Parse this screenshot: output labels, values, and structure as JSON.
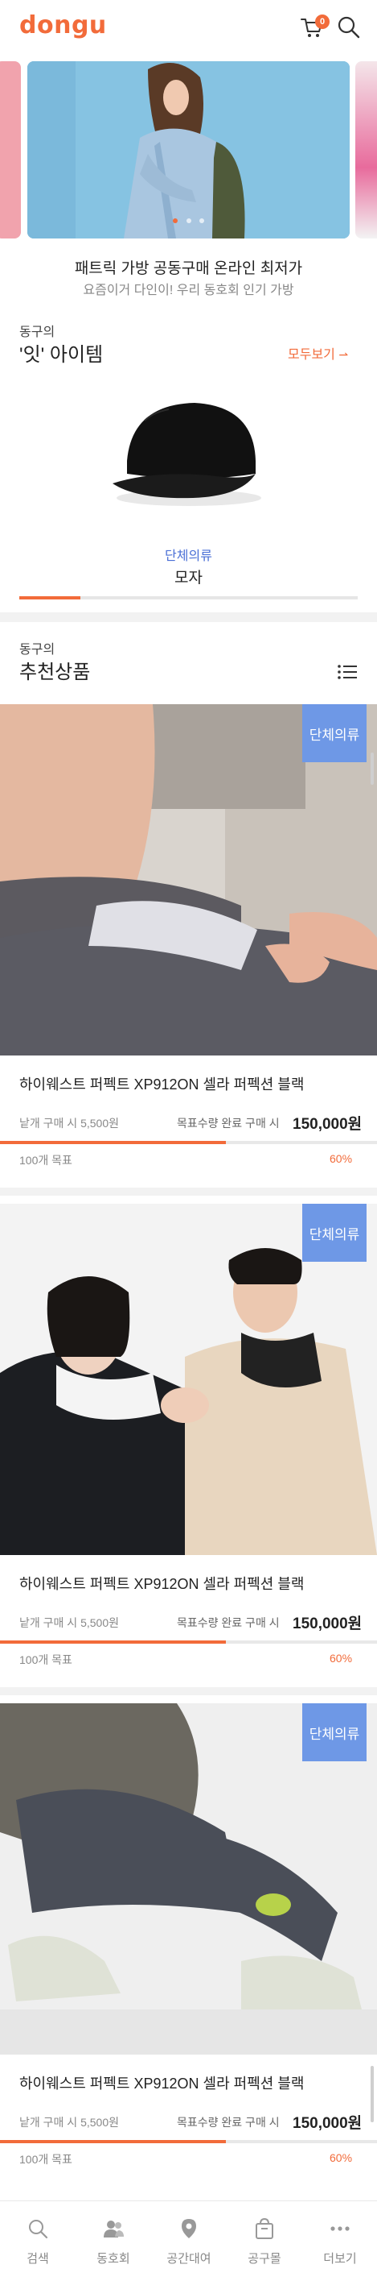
{
  "header": {
    "logo": "dongu",
    "cart_count": "0"
  },
  "banner": {
    "title": "패트릭 가방 공동구매 온라인 최저가",
    "subtitle": "요즘이거 다인이! 우리 동호회 인기 가방",
    "slide_count": 3,
    "active_slide": 1
  },
  "it_items": {
    "eyebrow": "동구의",
    "title": "'잇' 아이템",
    "see_all": "모두보기",
    "item": {
      "category": "단체의류",
      "name": "모자"
    },
    "scroll_progress": 0.18
  },
  "recommended": {
    "eyebrow": "동구의",
    "title": "추천상품",
    "products": [
      {
        "badge": "단체의류",
        "name": "하이웨스트 퍼펙트 XP912ON 셀라 퍼펙션 블랙",
        "unit_price_label": "낱개 구매 시 5,500원",
        "goal_label": "목표수량 완료 구매 시",
        "goal_price": "150,000원",
        "target": "100개 목표",
        "percent_label": "60%",
        "progress": 0.6
      },
      {
        "badge": "단체의류",
        "name": "하이웨스트 퍼펙트 XP912ON 셀라 퍼펙션 블랙",
        "unit_price_label": "낱개 구매 시 5,500원",
        "goal_label": "목표수량 완료 구매 시",
        "goal_price": "150,000원",
        "target": "100개 목표",
        "percent_label": "60%",
        "progress": 0.6
      },
      {
        "badge": "단체의류",
        "name": "하이웨스트 퍼펙트 XP912ON 셀라 퍼펙션 블랙",
        "unit_price_label": "낱개 구매 시 5,500원",
        "goal_label": "목표수량 완료 구매 시",
        "goal_price": "150,000원",
        "target": "100개 목표",
        "percent_label": "60%",
        "progress": 0.6
      }
    ]
  },
  "bottom_nav": {
    "items": [
      {
        "label": "검색",
        "icon": "search-icon"
      },
      {
        "label": "동호회",
        "icon": "community-icon"
      },
      {
        "label": "공간대여",
        "icon": "location-pin-icon"
      },
      {
        "label": "공구몰",
        "icon": "shopping-bag-icon"
      },
      {
        "label": "더보기",
        "icon": "more-icon"
      }
    ]
  },
  "colors": {
    "accent": "#f26b3a",
    "category_blue": "#4a6fd6",
    "badge_blue": "#6e98e6"
  }
}
